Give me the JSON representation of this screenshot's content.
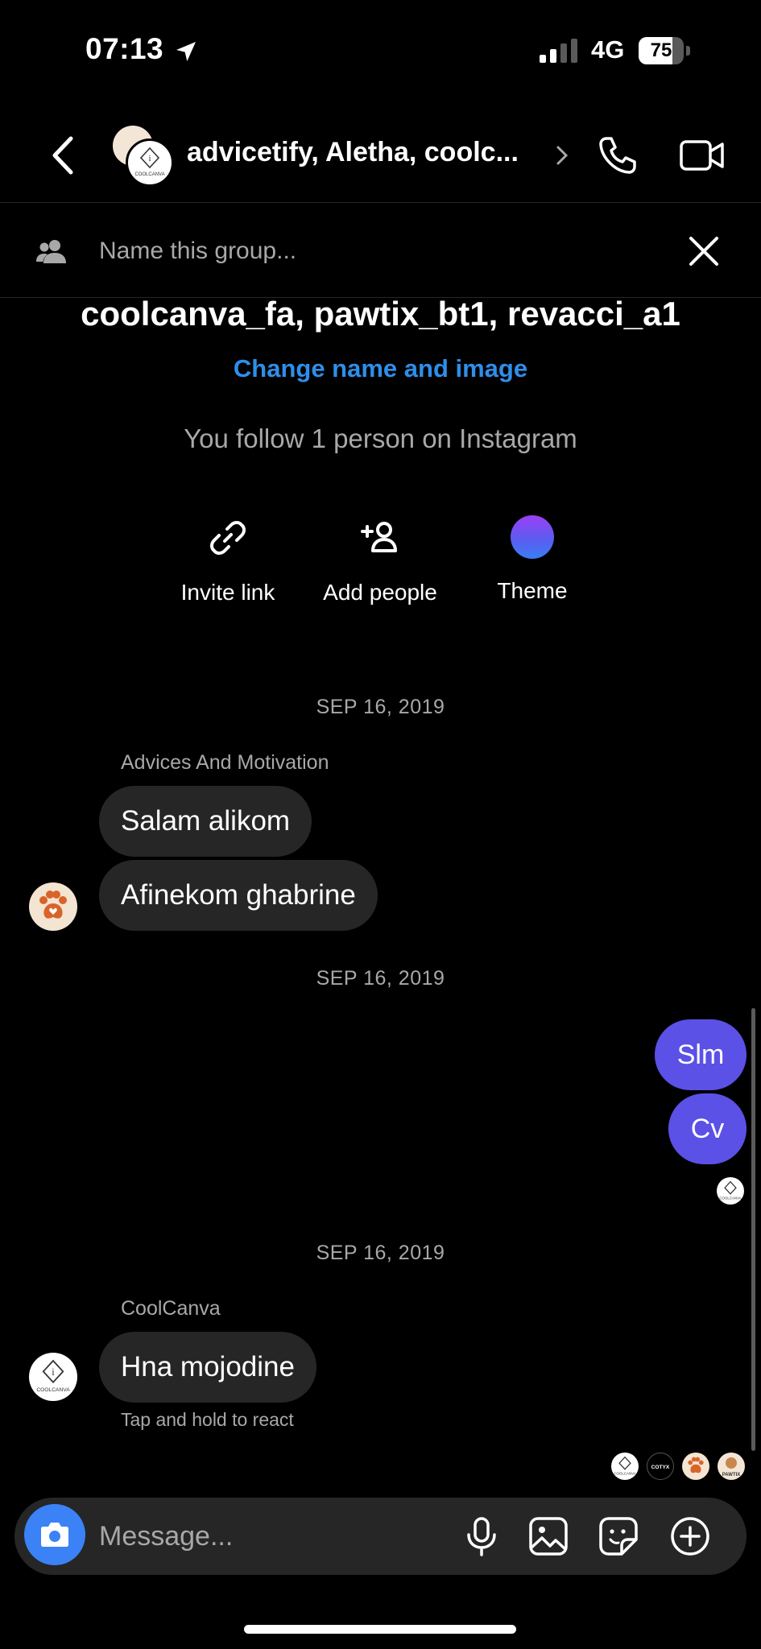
{
  "status_bar": {
    "time": "07:13",
    "network": "4G",
    "battery": "75",
    "battery_level": 0.75
  },
  "header": {
    "title": "advicetify, Aletha, coolc...",
    "avatar_text": "COOLCANVA"
  },
  "group_name": {
    "placeholder": "Name this group..."
  },
  "members": "coolcanva_fa, pawtix_bt1, revacci_a1",
  "change_link": "Change name and image",
  "follow_info": "You follow 1 person on Instagram",
  "actions": [
    {
      "label": "Invite link",
      "icon": "link-icon"
    },
    {
      "label": "Add people",
      "icon": "add-person-icon"
    },
    {
      "label": "Theme",
      "icon": "theme-icon"
    }
  ],
  "thread": {
    "date1": "SEP 16, 2019",
    "sender1": "Advices And Motivation",
    "msg1": "Salam alikom",
    "msg2": "Afinekom ghabrine",
    "date2": "SEP 16, 2019",
    "out1": "Slm",
    "out2": "Cv",
    "date3": "SEP 16, 2019",
    "sender2": "CoolCanva",
    "msg3": "Hna mojodine",
    "hint": "Tap and hold to react",
    "avatar_text": "COOLCANVA",
    "seen_labels": [
      "COOLCANVA",
      "COTYX",
      "PAWTIX"
    ]
  },
  "composer": {
    "placeholder": "Message..."
  },
  "colors": {
    "outgoing_bubble": "#5b51e6",
    "incoming_bubble": "#262626",
    "link": "#2d8fea",
    "camera_button": "#3b82f6"
  }
}
